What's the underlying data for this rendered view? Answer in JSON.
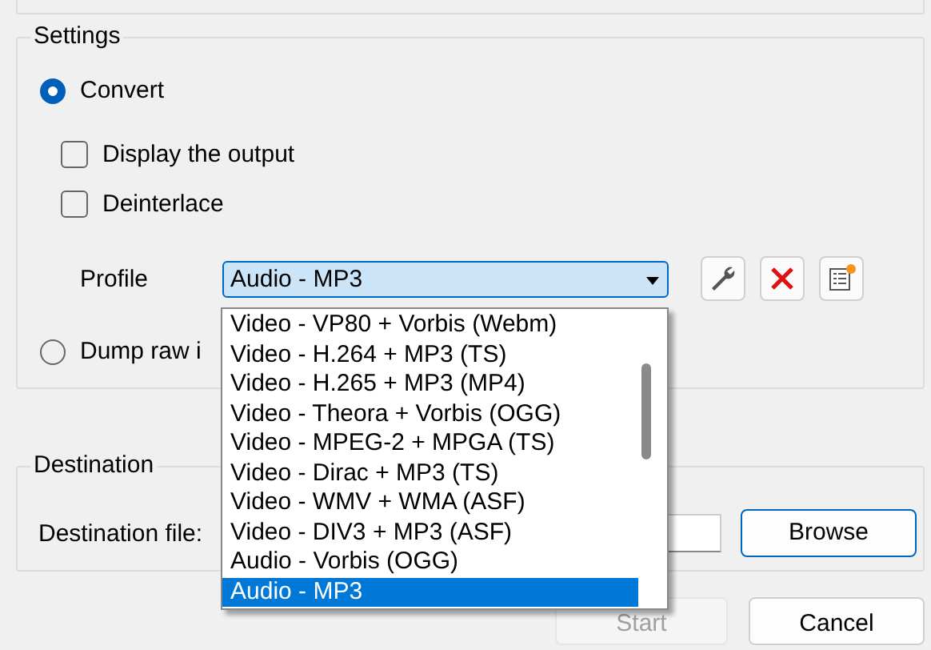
{
  "settings": {
    "title": "Settings",
    "modes": [
      {
        "label": "Convert",
        "selected": true
      },
      {
        "label": "Dump raw i",
        "selected": false
      }
    ],
    "options": [
      {
        "label": "Display the output",
        "checked": false
      },
      {
        "label": "Deinterlace",
        "checked": false
      }
    ],
    "profile": {
      "label": "Profile",
      "value": "Audio - MP3",
      "options": [
        {
          "label": "Video - VP80 + Vorbis (Webm)",
          "selected": false
        },
        {
          "label": "Video - H.264 + MP3 (TS)",
          "selected": false
        },
        {
          "label": "Video - H.265 + MP3 (MP4)",
          "selected": false
        },
        {
          "label": "Video - Theora + Vorbis (OGG)",
          "selected": false
        },
        {
          "label": "Video - MPEG-2 + MPGA (TS)",
          "selected": false
        },
        {
          "label": "Video - Dirac + MP3 (TS)",
          "selected": false
        },
        {
          "label": "Video - WMV + WMA (ASF)",
          "selected": false
        },
        {
          "label": "Video - DIV3 + MP3 (ASF)",
          "selected": false
        },
        {
          "label": "Audio - Vorbis (OGG)",
          "selected": false
        },
        {
          "label": "Audio - MP3",
          "selected": true
        }
      ]
    }
  },
  "destination": {
    "title": "Destination",
    "label": "Destination file:",
    "browse": "Browse"
  },
  "buttons": [
    {
      "label": "Start",
      "disabled": true
    },
    {
      "label": "Cancel",
      "disabled": false
    }
  ]
}
